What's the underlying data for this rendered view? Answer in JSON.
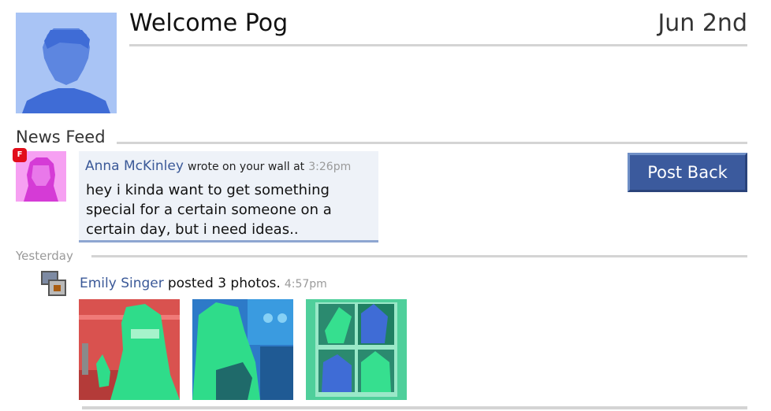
{
  "header": {
    "welcome": "Welcome Pog",
    "date": "Jun 2nd"
  },
  "feed": {
    "title": "News Feed",
    "wall_post": {
      "author": "Anna McKinley",
      "action": "wrote on your wall at",
      "time": "3:26pm",
      "message": "hey i kinda want to get something special for a certain someone on a certain day, but i need ideas..",
      "reply_button": "Post Back",
      "notification_badge": "F"
    },
    "section_label": "Yesterday",
    "photo_post": {
      "author": "Emily Singer",
      "action": "posted 3 photos.",
      "time": "4:57pm",
      "photos": [
        "photo-1",
        "photo-2",
        "photo-3"
      ]
    }
  },
  "colors": {
    "link": "#3b5998",
    "button": "#3b5a9d",
    "rule": "#d4d4d4",
    "wall_bg": "#eef2f8"
  },
  "icons": {
    "profile": "pixel-avatar-icon",
    "notification": "notification-badge-icon",
    "photos": "photos-stack-icon"
  }
}
